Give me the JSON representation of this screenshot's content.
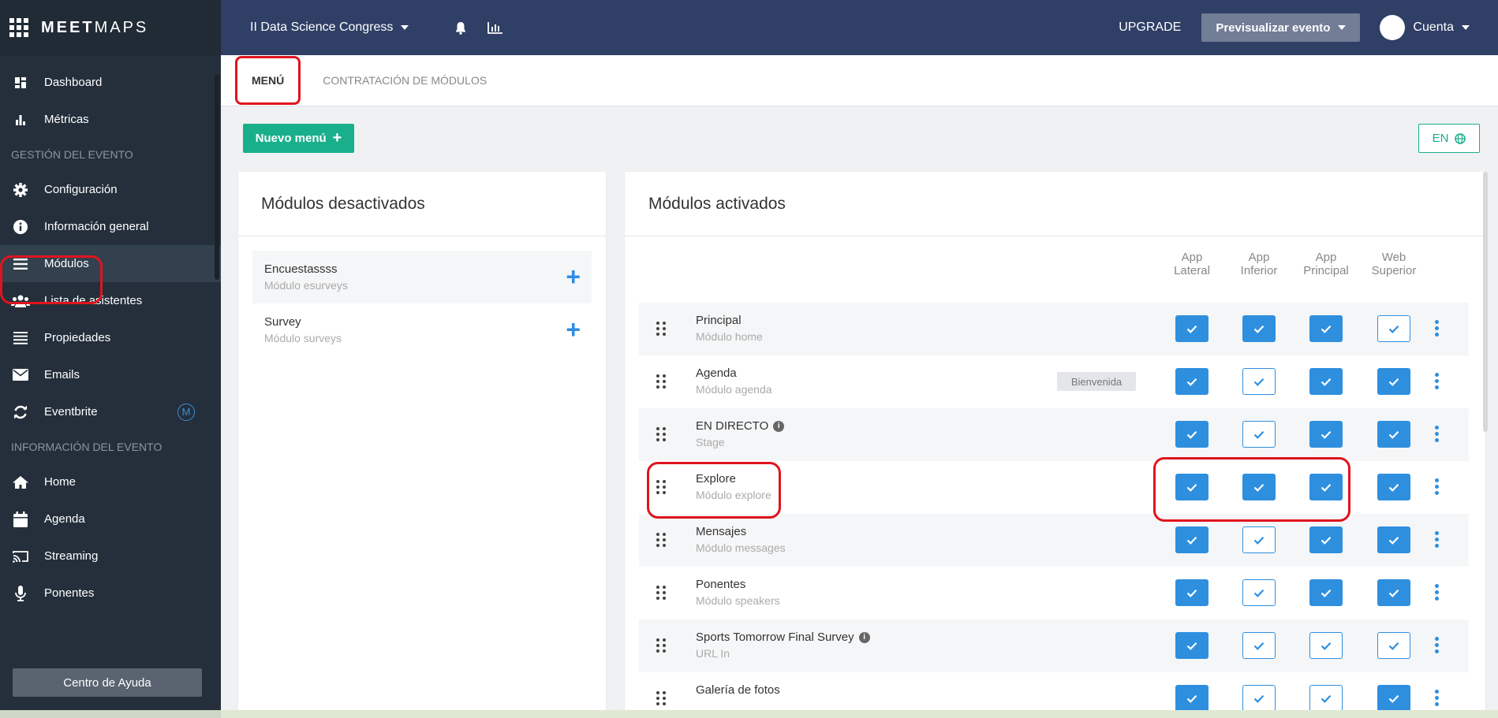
{
  "brand": {
    "light": "MEET",
    "bold": "MAPS"
  },
  "sidebar": {
    "top_items": [
      {
        "label": "Dashboard",
        "icon": "dashboard-icon"
      },
      {
        "label": "Métricas",
        "icon": "bar-chart-icon"
      }
    ],
    "section1": "GESTIÓN DEL EVENTO",
    "event_items": [
      {
        "label": "Configuración",
        "icon": "gear-icon"
      },
      {
        "label": "Información general",
        "icon": "info-icon"
      },
      {
        "label": "Módulos",
        "icon": "menu-icon"
      },
      {
        "label": "Lista de asistentes",
        "icon": "users-icon"
      },
      {
        "label": "Propiedades",
        "icon": "list-icon"
      },
      {
        "label": "Emails",
        "icon": "envelope-icon"
      },
      {
        "label": "Eventbrite",
        "icon": "sync-icon",
        "badge": "M"
      }
    ],
    "section2": "INFORMACIÓN DEL EVENTO",
    "info_items": [
      {
        "label": "Home",
        "icon": "home-icon"
      },
      {
        "label": "Agenda",
        "icon": "calendar-icon"
      },
      {
        "label": "Streaming",
        "icon": "cast-icon"
      },
      {
        "label": "Ponentes",
        "icon": "microphone-icon"
      }
    ],
    "help": "Centro de Ayuda"
  },
  "topbar": {
    "event": "II Data Science Congress",
    "upgrade": "UPGRADE",
    "preview": "Previsualizar evento",
    "account": "Cuenta"
  },
  "tabs": [
    "MENÚ",
    "CONTRATACIÓN DE MÓDULOS"
  ],
  "toolbar": {
    "new_menu": "Nuevo menú",
    "lang": "EN"
  },
  "inactive": {
    "title": "Módulos desactivados",
    "items": [
      {
        "name": "Encuestassss",
        "sub": "Módulo esurveys"
      },
      {
        "name": "Survey",
        "sub": "Módulo surveys"
      }
    ]
  },
  "active": {
    "title": "Módulos activados",
    "columns": [
      {
        "l1": "App",
        "l2": "Lateral"
      },
      {
        "l1": "App",
        "l2": "Inferior"
      },
      {
        "l1": "App",
        "l2": "Principal"
      },
      {
        "l1": "Web",
        "l2": "Superior"
      }
    ],
    "rows": [
      {
        "name": "Principal",
        "sub": "Módulo home",
        "checks": [
          true,
          true,
          true,
          false
        ]
      },
      {
        "name": "Agenda",
        "sub": "Módulo agenda",
        "tag": "Bienvenida",
        "checks": [
          true,
          false,
          true,
          true
        ]
      },
      {
        "name": "EN DIRECTO",
        "sub": "Stage",
        "info": true,
        "checks": [
          true,
          false,
          true,
          true
        ]
      },
      {
        "name": "Explore",
        "sub": "Módulo explore",
        "checks": [
          true,
          true,
          true,
          true
        ]
      },
      {
        "name": "Mensajes",
        "sub": "Módulo messages",
        "checks": [
          true,
          false,
          true,
          true
        ]
      },
      {
        "name": "Ponentes",
        "sub": "Módulo speakers",
        "checks": [
          true,
          false,
          true,
          true
        ]
      },
      {
        "name": "Sports Tomorrow Final Survey",
        "sub": "URL In",
        "info": true,
        "checks": [
          true,
          false,
          false,
          false
        ]
      },
      {
        "name": "Galería de fotos",
        "sub": "",
        "checks": [
          true,
          false,
          false,
          true
        ]
      }
    ]
  },
  "colors": {
    "accent_green": "#1aaf8b",
    "accent_blue": "#2e8fdf",
    "topbar": "#2f3f66",
    "sidebar": "#242f3b",
    "annotation": "#e0141e"
  }
}
